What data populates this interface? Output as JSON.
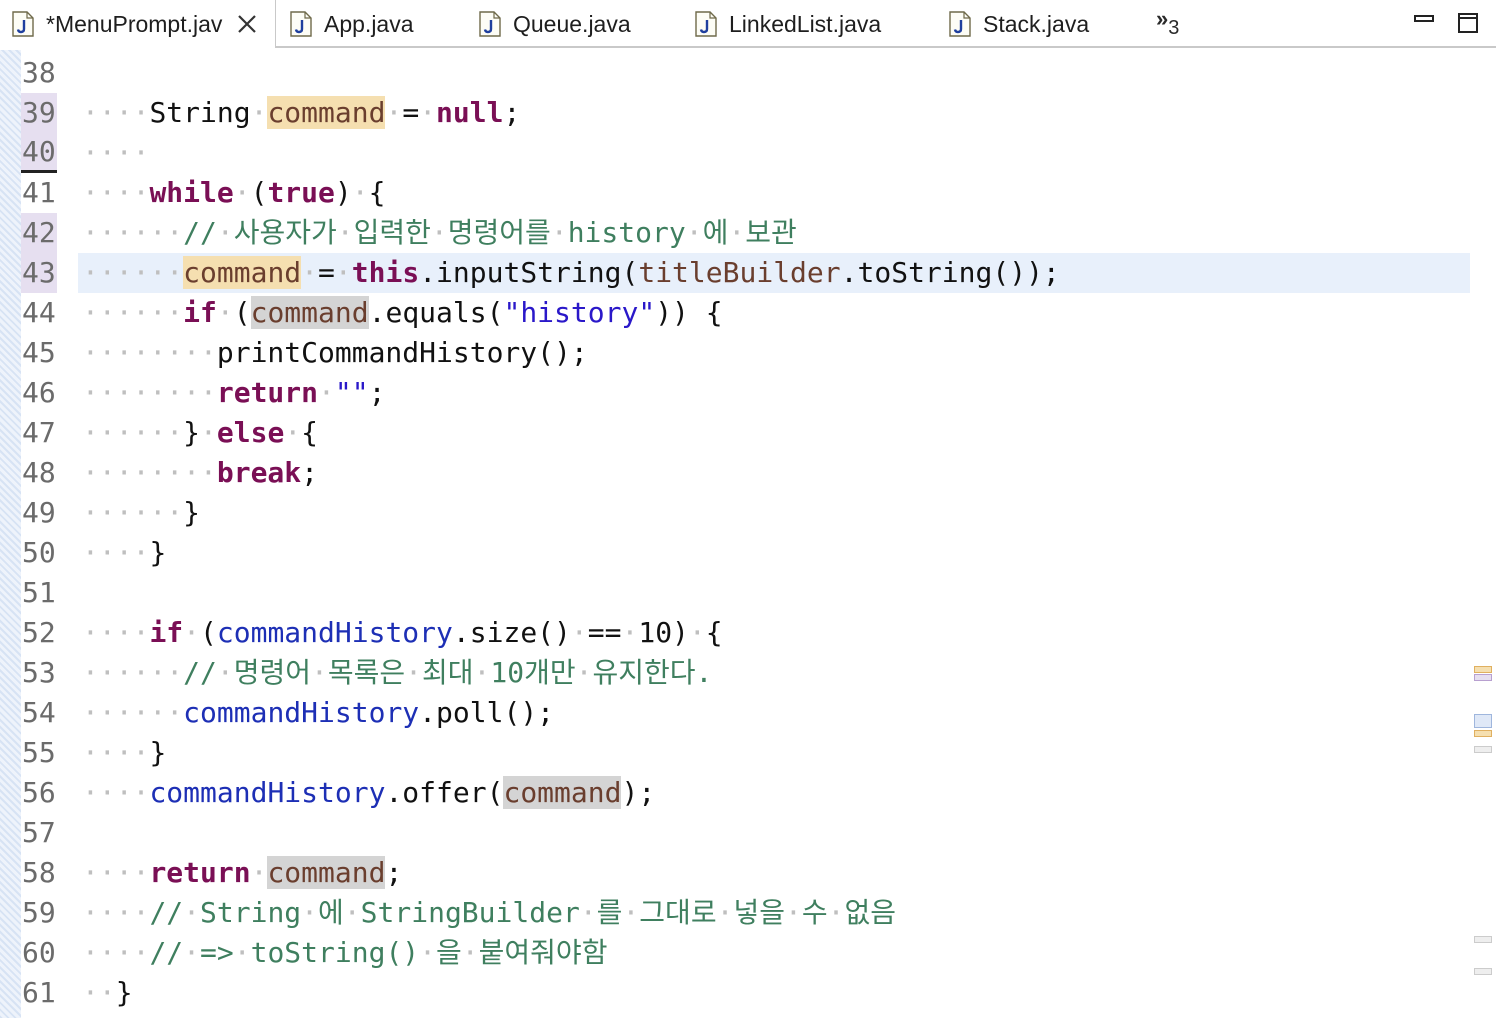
{
  "tabs": [
    {
      "label": "*MenuPrompt.jav",
      "active": true,
      "closable": true,
      "icon": "java-file-icon"
    },
    {
      "label": "App.java",
      "active": false,
      "icon": "java-file-icon"
    },
    {
      "label": "Queue.java",
      "active": false,
      "icon": "java-file-icon"
    },
    {
      "label": "LinkedList.java",
      "active": false,
      "icon": "java-file-icon"
    },
    {
      "label": "Stack.java",
      "active": false,
      "icon": "java-file-icon"
    }
  ],
  "overflow": {
    "chevron": "»",
    "count": "3"
  },
  "window_controls": [
    "minimize-icon",
    "maximize-icon"
  ],
  "colors": {
    "keyword": "#7a0f55",
    "field": "#1d2fb5",
    "string": "#2a18c9",
    "comment": "#3f7f5f",
    "local_variable": "#6a3e2e",
    "occurrence_write": "#f5dfb0",
    "occurrence_read": "#d4d4d4",
    "current_line": "#e8f0fb"
  },
  "editor": {
    "current_line_number": 43,
    "lines": [
      {
        "n": "38",
        "tokens": []
      },
      {
        "n": "39",
        "tokens": [
          [
            "d",
            "····"
          ],
          [
            "t",
            "String"
          ],
          [
            "d",
            "·"
          ],
          [
            "v",
            "command",
            "w"
          ],
          [
            "d",
            "·"
          ],
          [
            "t",
            "="
          ],
          [
            "d",
            "·"
          ],
          [
            "k",
            "null"
          ],
          [
            "t",
            ";"
          ]
        ]
      },
      {
        "n": "40",
        "tokens": [
          [
            "d",
            "····"
          ]
        ]
      },
      {
        "n": "41",
        "tokens": [
          [
            "d",
            "····"
          ],
          [
            "k",
            "while"
          ],
          [
            "d",
            "·"
          ],
          [
            "t",
            "("
          ],
          [
            "k",
            "true"
          ],
          [
            "t",
            ")"
          ],
          [
            "d",
            "·"
          ],
          [
            "t",
            "{"
          ]
        ]
      },
      {
        "n": "42",
        "tokens": [
          [
            "d",
            "······"
          ],
          [
            "c",
            "//"
          ],
          [
            "d",
            "·"
          ],
          [
            "c",
            "사용자가"
          ],
          [
            "d",
            "·"
          ],
          [
            "c",
            "입력한"
          ],
          [
            "d",
            "·"
          ],
          [
            "c",
            "명령어를"
          ],
          [
            "d",
            "·"
          ],
          [
            "c",
            "history"
          ],
          [
            "d",
            "·"
          ],
          [
            "c",
            "에"
          ],
          [
            "d",
            "·"
          ],
          [
            "c",
            "보관"
          ]
        ]
      },
      {
        "n": "43",
        "tokens": [
          [
            "d",
            "······"
          ],
          [
            "v",
            "command",
            "w"
          ],
          [
            "d",
            "·"
          ],
          [
            "t",
            "="
          ],
          [
            "d",
            "·"
          ],
          [
            "k",
            "this"
          ],
          [
            "t",
            ".inputString("
          ],
          [
            "v",
            "titleBuilder"
          ],
          [
            "t",
            ".toString());"
          ]
        ]
      },
      {
        "n": "44",
        "tokens": [
          [
            "d",
            "······"
          ],
          [
            "k",
            "if"
          ],
          [
            "d",
            "·"
          ],
          [
            "t",
            "("
          ],
          [
            "v",
            "command",
            "r"
          ],
          [
            "t",
            ".equals("
          ],
          [
            "s",
            "\"history\""
          ],
          [
            "t",
            ")) {"
          ]
        ]
      },
      {
        "n": "45",
        "tokens": [
          [
            "d",
            "········"
          ],
          [
            "t",
            "printCommandHistory();"
          ]
        ]
      },
      {
        "n": "46",
        "tokens": [
          [
            "d",
            "········"
          ],
          [
            "k",
            "return"
          ],
          [
            "d",
            "·"
          ],
          [
            "s",
            "\"\""
          ],
          [
            "t",
            ";"
          ]
        ]
      },
      {
        "n": "47",
        "tokens": [
          [
            "d",
            "······"
          ],
          [
            "t",
            "}"
          ],
          [
            "d",
            "·"
          ],
          [
            "k",
            "else"
          ],
          [
            "d",
            "·"
          ],
          [
            "t",
            "{"
          ]
        ]
      },
      {
        "n": "48",
        "tokens": [
          [
            "d",
            "········"
          ],
          [
            "k",
            "break"
          ],
          [
            "t",
            ";"
          ]
        ]
      },
      {
        "n": "49",
        "tokens": [
          [
            "d",
            "······"
          ],
          [
            "t",
            "}"
          ]
        ]
      },
      {
        "n": "50",
        "tokens": [
          [
            "d",
            "····"
          ],
          [
            "t",
            "}"
          ]
        ]
      },
      {
        "n": "51",
        "tokens": []
      },
      {
        "n": "52",
        "tokens": [
          [
            "d",
            "····"
          ],
          [
            "k",
            "if"
          ],
          [
            "d",
            "·"
          ],
          [
            "t",
            "("
          ],
          [
            "f",
            "commandHistory"
          ],
          [
            "t",
            ".size()"
          ],
          [
            "d",
            "·"
          ],
          [
            "t",
            "=="
          ],
          [
            "d",
            "·"
          ],
          [
            "t",
            "10)"
          ],
          [
            "d",
            "·"
          ],
          [
            "t",
            "{"
          ]
        ]
      },
      {
        "n": "53",
        "tokens": [
          [
            "d",
            "······"
          ],
          [
            "c",
            "//"
          ],
          [
            "d",
            "·"
          ],
          [
            "c",
            "명령어"
          ],
          [
            "d",
            "·"
          ],
          [
            "c",
            "목록은"
          ],
          [
            "d",
            "·"
          ],
          [
            "c",
            "최대"
          ],
          [
            "d",
            "·"
          ],
          [
            "c",
            "10개만"
          ],
          [
            "d",
            "·"
          ],
          [
            "c",
            "유지한다."
          ]
        ]
      },
      {
        "n": "54",
        "tokens": [
          [
            "d",
            "······"
          ],
          [
            "f",
            "commandHistory"
          ],
          [
            "t",
            ".poll();"
          ]
        ]
      },
      {
        "n": "55",
        "tokens": [
          [
            "d",
            "····"
          ],
          [
            "t",
            "}"
          ]
        ]
      },
      {
        "n": "56",
        "tokens": [
          [
            "d",
            "····"
          ],
          [
            "f",
            "commandHistory"
          ],
          [
            "t",
            ".offer("
          ],
          [
            "v",
            "command",
            "r"
          ],
          [
            "t",
            ");"
          ]
        ]
      },
      {
        "n": "57",
        "tokens": []
      },
      {
        "n": "58",
        "tokens": [
          [
            "d",
            "····"
          ],
          [
            "k",
            "return"
          ],
          [
            "d",
            "·"
          ],
          [
            "v",
            "command",
            "r"
          ],
          [
            "t",
            ";"
          ]
        ]
      },
      {
        "n": "59",
        "tokens": [
          [
            "d",
            "····"
          ],
          [
            "c",
            "//"
          ],
          [
            "d",
            "·"
          ],
          [
            "c",
            "String"
          ],
          [
            "d",
            "·"
          ],
          [
            "c",
            "에"
          ],
          [
            "d",
            "·"
          ],
          [
            "c",
            "StringBuilder"
          ],
          [
            "d",
            "·"
          ],
          [
            "c",
            "를"
          ],
          [
            "d",
            "·"
          ],
          [
            "c",
            "그대로"
          ],
          [
            "d",
            "·"
          ],
          [
            "c",
            "넣을"
          ],
          [
            "d",
            "·"
          ],
          [
            "c",
            "수"
          ],
          [
            "d",
            "·"
          ],
          [
            "c",
            "없음"
          ]
        ]
      },
      {
        "n": "60",
        "tokens": [
          [
            "d",
            "····"
          ],
          [
            "c",
            "//"
          ],
          [
            "d",
            "·"
          ],
          [
            "c",
            "=>"
          ],
          [
            "d",
            "·"
          ],
          [
            "c",
            "toString()"
          ],
          [
            "d",
            "·"
          ],
          [
            "c",
            "을"
          ],
          [
            "d",
            "·"
          ],
          [
            "c",
            "붙여줘야함"
          ]
        ]
      },
      {
        "n": "61",
        "tokens": [
          [
            "d",
            "··"
          ],
          [
            "t",
            "}"
          ]
        ]
      }
    ]
  }
}
